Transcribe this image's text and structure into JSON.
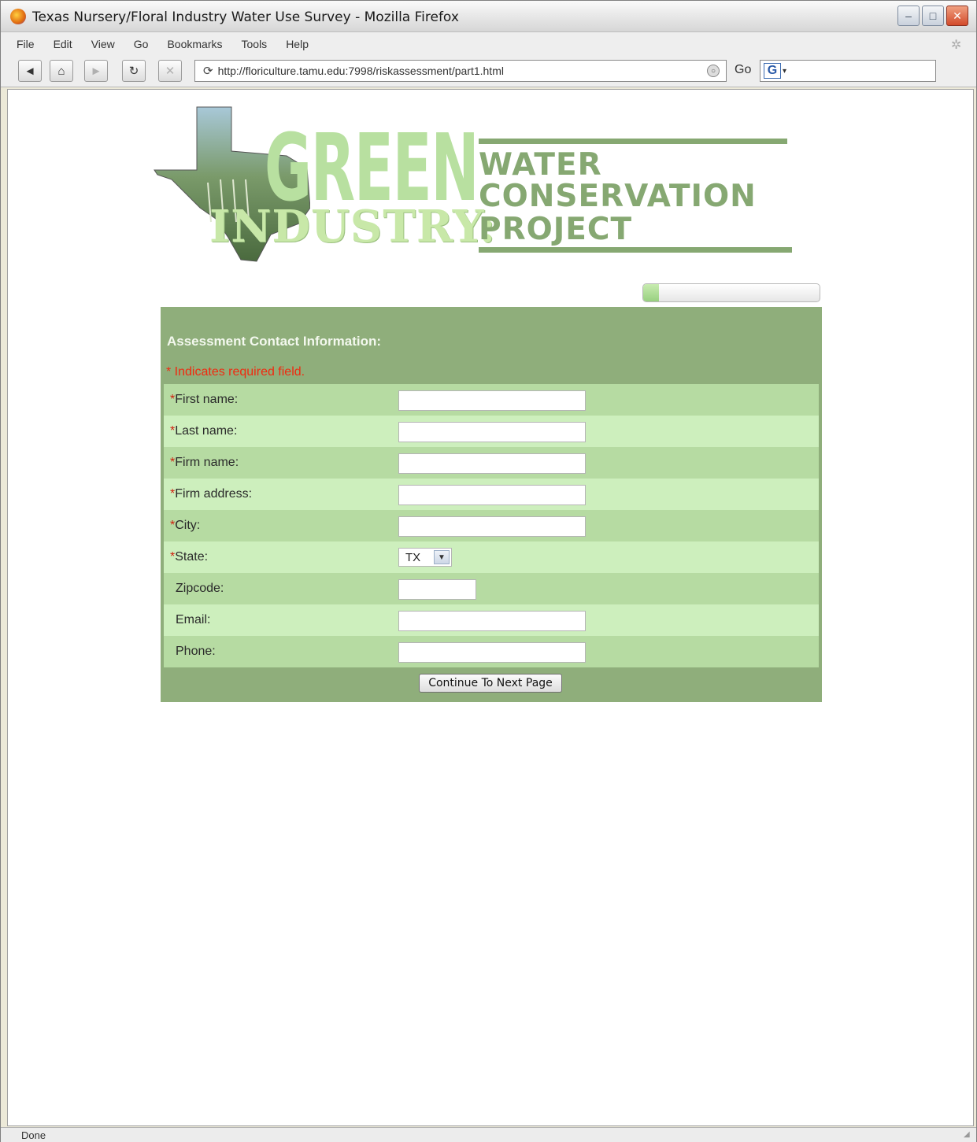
{
  "window": {
    "title": "Texas Nursery/Floral Industry Water Use Survey - Mozilla Firefox",
    "controls": {
      "minimize": "–",
      "maximize": "□",
      "close": "✕"
    }
  },
  "menu": {
    "items": [
      "File",
      "Edit",
      "View",
      "Go",
      "Bookmarks",
      "Tools",
      "Help"
    ]
  },
  "navigation": {
    "back_icon": "◄",
    "home_icon": "⌂",
    "forward_icon": "►",
    "reload_icon": "↻",
    "stop_icon": "✕",
    "url": "http://floriculture.tamu.edu:7998/riskassessment/part1.html",
    "go_label": "Go",
    "search_engine": "G"
  },
  "banner": {
    "word_green": "GREEN",
    "word_industry": "INDUSTRY:",
    "line1": "WATER",
    "line2": "CONSERVATION",
    "line3": "PROJECT"
  },
  "progress": {
    "fraction": 0.09
  },
  "form": {
    "heading": "Assessment Contact Information:",
    "required_note": "* Indicates required field.",
    "required_marker": "*",
    "fields": {
      "first_name": {
        "label": "First name:",
        "value": ""
      },
      "last_name": {
        "label": "Last name:",
        "value": ""
      },
      "firm_name": {
        "label": "Firm name:",
        "value": ""
      },
      "firm_address": {
        "label": "Firm address:",
        "value": ""
      },
      "city": {
        "label": "City:",
        "value": ""
      },
      "state": {
        "label": "State:",
        "value": "TX"
      },
      "zipcode": {
        "label": "Zipcode:",
        "value": ""
      },
      "email": {
        "label": "Email:",
        "value": ""
      },
      "phone": {
        "label": "Phone:",
        "value": ""
      }
    },
    "submit_label": "Continue To Next Page"
  },
  "status": {
    "text": "Done"
  },
  "colors": {
    "panel": "#8fae7b",
    "row_dark": "#b6dba2",
    "row_light": "#cdefbd",
    "required": "#d02010",
    "logo_green": "#86a872"
  }
}
